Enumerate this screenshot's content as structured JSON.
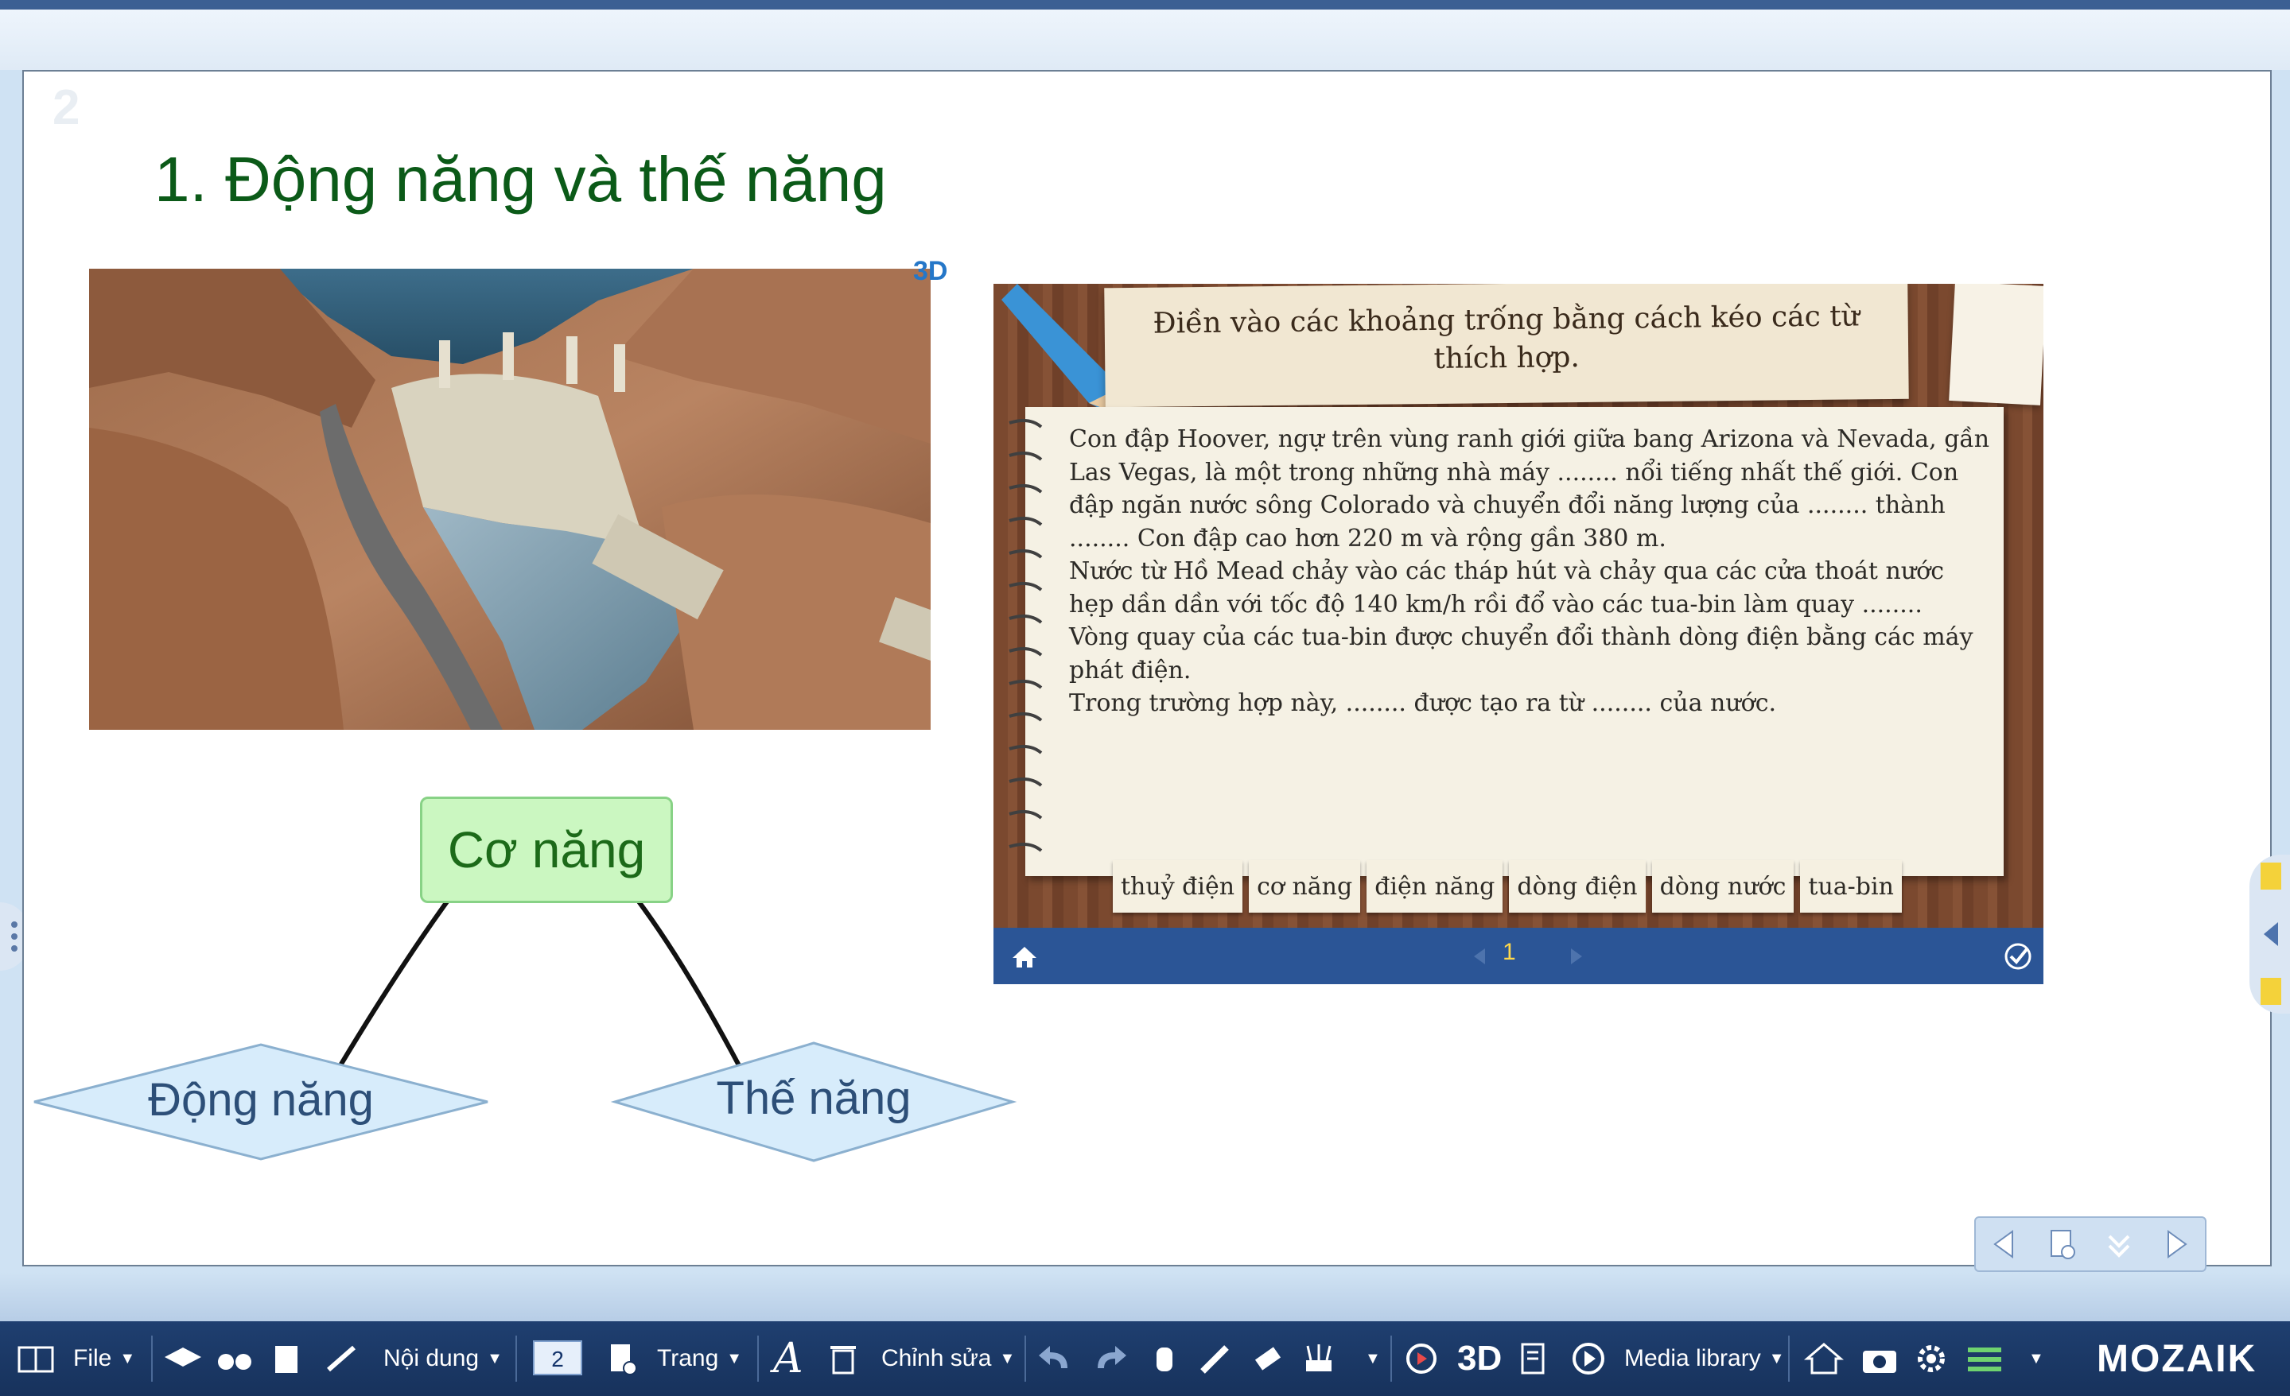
{
  "page": {
    "number": "2",
    "title": "1. Động năng và thế năng"
  },
  "image": {
    "badge": "3D"
  },
  "concept_map": {
    "root": "Cơ năng",
    "left": "Động năng",
    "right": "Thế năng"
  },
  "exercise": {
    "instruction": "Điền vào các khoảng trống bằng cách kéo các từ thích hợp.",
    "paragraphs": [
      "Con đập Hoover, ngự trên vùng ranh giới giữa bang Arizona và Nevada, gần Las Vegas, là một trong những nhà máy ........ nổi tiếng nhất thế giới. Con đập ngăn nước sông Colorado và chuyển đổi năng lượng của ........ thành ........ Con đập cao hơn 220 m và rộng gần 380 m.",
      "Nước từ Hồ Mead chảy vào các tháp hút và chảy qua các cửa thoát nước hẹp dần dần với tốc độ 140 km/h rồi đổ vào các tua-bin làm quay ........",
      "Vòng quay của các tua-bin được chuyển đổi thành dòng điện bằng các máy phát điện.",
      "Trong trường hợp này, ........ được tạo ra từ ........ của nước."
    ],
    "words": [
      "thuỷ điện",
      "cơ năng",
      "điện năng",
      "dòng điện",
      "dòng nước",
      "tua-bin"
    ],
    "current_page": "1"
  },
  "toolbar": {
    "file": "File",
    "content": "Nội dung",
    "page_number": "2",
    "page": "Trang",
    "edit": "Chỉnh sửa",
    "media": "Media library",
    "logo": "MOZAIK"
  },
  "colors": {
    "title_green": "#0b5a18",
    "toolbar_blue": "#1f3f70",
    "widget_nav": "#2b5596"
  }
}
